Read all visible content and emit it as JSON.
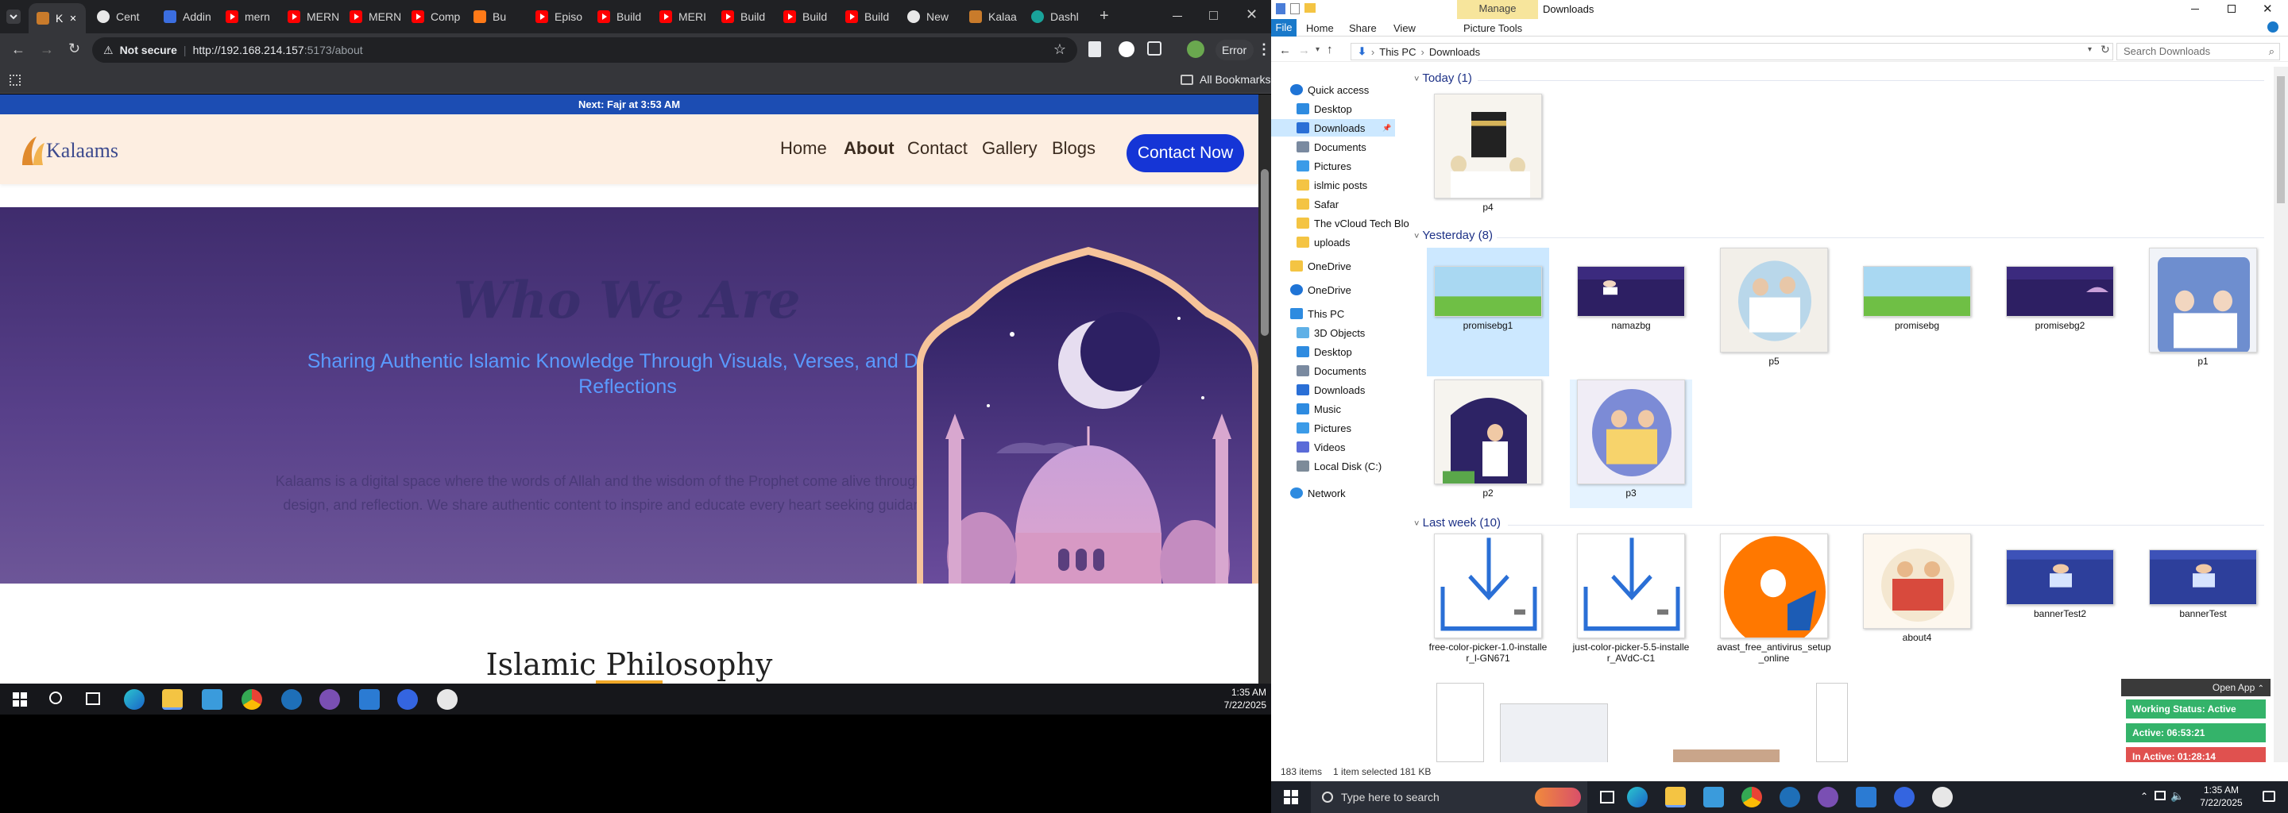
{
  "browser": {
    "tabs": [
      {
        "label": "K",
        "icon": "kalaams-favicon",
        "active": true
      },
      {
        "label": "Cent",
        "icon": "github-icon"
      },
      {
        "label": "Addin",
        "icon": "dev-icon"
      },
      {
        "label": "mern",
        "icon": "youtube-icon"
      },
      {
        "label": "MERN",
        "icon": "youtube-icon"
      },
      {
        "label": "MERN",
        "icon": "youtube-icon"
      },
      {
        "label": "Comp",
        "icon": "youtube-icon"
      },
      {
        "label": "Bu",
        "icon": "fire-icon"
      },
      {
        "label": "Episo",
        "icon": "youtube-icon"
      },
      {
        "label": "Build",
        "icon": "youtube-icon"
      },
      {
        "label": "MERI",
        "icon": "youtube-icon"
      },
      {
        "label": "Build",
        "icon": "youtube-icon"
      },
      {
        "label": "Build",
        "icon": "youtube-icon"
      },
      {
        "label": "Build",
        "icon": "youtube-icon"
      },
      {
        "label": "New",
        "icon": "github-icon"
      },
      {
        "label": "Kalaa",
        "icon": "kalaams-favicon"
      },
      {
        "label": "Dashl",
        "icon": "teal-icon"
      }
    ],
    "not_secure": "Not secure",
    "url_host": "http://192.168.214.157",
    "url_path": ":5173/about",
    "profile_error": "Error",
    "all_bookmarks": "All Bookmarks"
  },
  "site": {
    "prayer": "Next: Fajr at 3:53 AM",
    "logo": "Kalaams",
    "nav": [
      "Home",
      "About",
      "Contact",
      "Gallery",
      "Blogs"
    ],
    "cta": "Contact Now",
    "hero_title": "Who We Are",
    "hero_sub": "Sharing Authentic Islamic Knowledge Through Visuals, Verses, and Daily Reflections",
    "hero_body": "Kalaams is a digital space where the words of Allah and the wisdom of the Prophet come alive through art, design, and reflection. We share authentic content to inspire and educate every heart seeking guidance.",
    "section_title": "Islamic Philosophy"
  },
  "taskbar_left": {
    "time": "1:35 AM",
    "date": "7/22/2025"
  },
  "explorer": {
    "title": "Downloads",
    "manage_tab": "Manage",
    "ribbon": [
      "File",
      "Home",
      "Share",
      "View",
      "Picture Tools"
    ],
    "breadcrumb": [
      "This PC",
      "Downloads"
    ],
    "search_placeholder": "Search Downloads",
    "sidebar": [
      {
        "label": "Quick access",
        "icon": "star-icon",
        "level": 0
      },
      {
        "label": "Desktop",
        "icon": "desktop-icon",
        "level": 1,
        "pin": true
      },
      {
        "label": "Downloads",
        "icon": "download-icon",
        "level": 1,
        "pin": true,
        "selected": true
      },
      {
        "label": "Documents",
        "icon": "document-icon",
        "level": 1,
        "pin": true
      },
      {
        "label": "Pictures",
        "icon": "pictures-icon",
        "level": 1,
        "pin": true
      },
      {
        "label": "islmic posts",
        "icon": "folder-icon",
        "level": 1
      },
      {
        "label": "Safar",
        "icon": "folder-icon",
        "level": 1
      },
      {
        "label": "The vCloud Tech Blo",
        "icon": "folder-icon",
        "level": 1
      },
      {
        "label": "uploads",
        "icon": "folder-icon",
        "level": 1
      },
      {
        "label": "OneDrive",
        "icon": "folder-icon",
        "level": 0
      },
      {
        "label": "OneDrive",
        "icon": "cloud-icon",
        "level": 0
      },
      {
        "label": "This PC",
        "icon": "pc-icon",
        "level": 0
      },
      {
        "label": "3D Objects",
        "icon": "cube-icon",
        "level": 1
      },
      {
        "label": "Desktop",
        "icon": "desktop-icon",
        "level": 1
      },
      {
        "label": "Documents",
        "icon": "document-icon",
        "level": 1
      },
      {
        "label": "Downloads",
        "icon": "download-icon",
        "level": 1
      },
      {
        "label": "Music",
        "icon": "music-icon",
        "level": 1
      },
      {
        "label": "Pictures",
        "icon": "pictures-icon",
        "level": 1
      },
      {
        "label": "Videos",
        "icon": "video-icon",
        "level": 1
      },
      {
        "label": "Local Disk (C:)",
        "icon": "disk-icon",
        "level": 1
      },
      {
        "label": "Network",
        "icon": "network-icon",
        "level": 0
      }
    ],
    "groups": [
      {
        "label": "Today (1)"
      },
      {
        "label": "Yesterday (8)"
      },
      {
        "label": "Last week (10)"
      }
    ],
    "files_today": [
      {
        "name": "p4",
        "kind": "kaaba"
      }
    ],
    "files_yesterday": [
      {
        "name": "promisebg1",
        "kind": "landscape",
        "selected": true
      },
      {
        "name": "namazbg",
        "kind": "purple-prayer"
      },
      {
        "name": "p5",
        "kind": "family"
      },
      {
        "name": "promisebg",
        "kind": "landscape"
      },
      {
        "name": "promisebg2",
        "kind": "purple-mosque"
      },
      {
        "name": "p1",
        "kind": "family-night"
      },
      {
        "name": "p2",
        "kind": "prayer"
      },
      {
        "name": "p3",
        "kind": "couple",
        "hover": true
      }
    ],
    "files_lastweek": [
      {
        "name": "free-color-picker-1.0-installer_l-GN671",
        "kind": "installer"
      },
      {
        "name": "just-color-picker-5.5-installer_AVdC-C1",
        "kind": "installer"
      },
      {
        "name": "avast_free_antivirus_setup_online",
        "kind": "avast"
      },
      {
        "name": "about4",
        "kind": "family-light"
      },
      {
        "name": "bannerTest2",
        "kind": "banner"
      },
      {
        "name": "bannerTest",
        "kind": "banner"
      }
    ],
    "status": {
      "count": "183 items",
      "selection": "1 item selected  181 KB"
    }
  },
  "work_widget": {
    "open_app": "Open App",
    "status": "Working Status: Active",
    "active": "Active: 06:53:21",
    "inactive": "In Active: 01:28:14"
  },
  "taskbar_right": {
    "search_placeholder": "Type here to search",
    "time": "1:35 AM",
    "date": "7/22/2025"
  },
  "colors": {
    "brand_blue": "#1535d6",
    "hero_purple": "#4a3579",
    "accent_orange": "#f0a828",
    "select_blue": "#cce8ff",
    "widget_green": "#3bb56b",
    "widget_red": "#e0514f"
  }
}
